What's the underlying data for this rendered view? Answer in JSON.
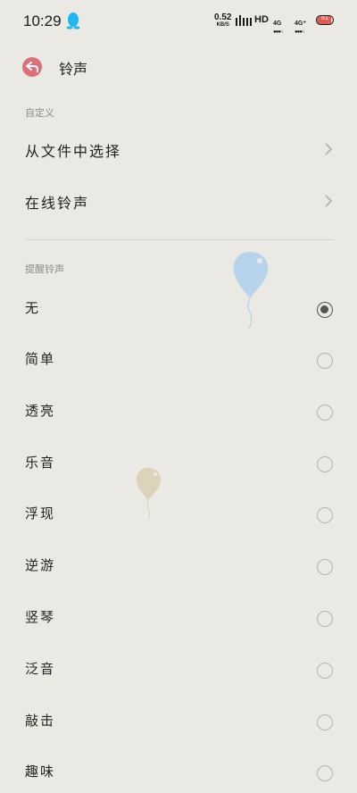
{
  "status_bar": {
    "time": "10:29",
    "net_speed_value": "0.52",
    "net_speed_unit": "KB/S",
    "hd_label": "HD",
    "signal1_label": "4G",
    "signal2_label": "4G⁺",
    "battery_level": "61",
    "battery_color": "#e05a55",
    "qq_icon": "penguin-icon"
  },
  "header": {
    "title": "铃声",
    "back_icon": "back-arrow-icon",
    "back_color": "#d9707a"
  },
  "custom_section": {
    "label": "自定义",
    "items": [
      {
        "label": "从文件中选择"
      },
      {
        "label": "在线铃声"
      }
    ]
  },
  "system_section": {
    "label": "提醒铃声",
    "selected_index": 0,
    "items": [
      {
        "label": "无",
        "checked": true
      },
      {
        "label": "简单",
        "checked": false
      },
      {
        "label": "透亮",
        "checked": false
      },
      {
        "label": "乐音",
        "checked": false
      },
      {
        "label": "浮现",
        "checked": false
      },
      {
        "label": "逆游",
        "checked": false
      },
      {
        "label": "竖琴",
        "checked": false
      },
      {
        "label": "泛音",
        "checked": false
      },
      {
        "label": "敲击",
        "checked": false
      },
      {
        "label": "趣味",
        "checked": false
      }
    ]
  },
  "decorations": {
    "balloon_blue_color": "#b8d4ec",
    "balloon_beige_color": "#ddd3bb"
  }
}
